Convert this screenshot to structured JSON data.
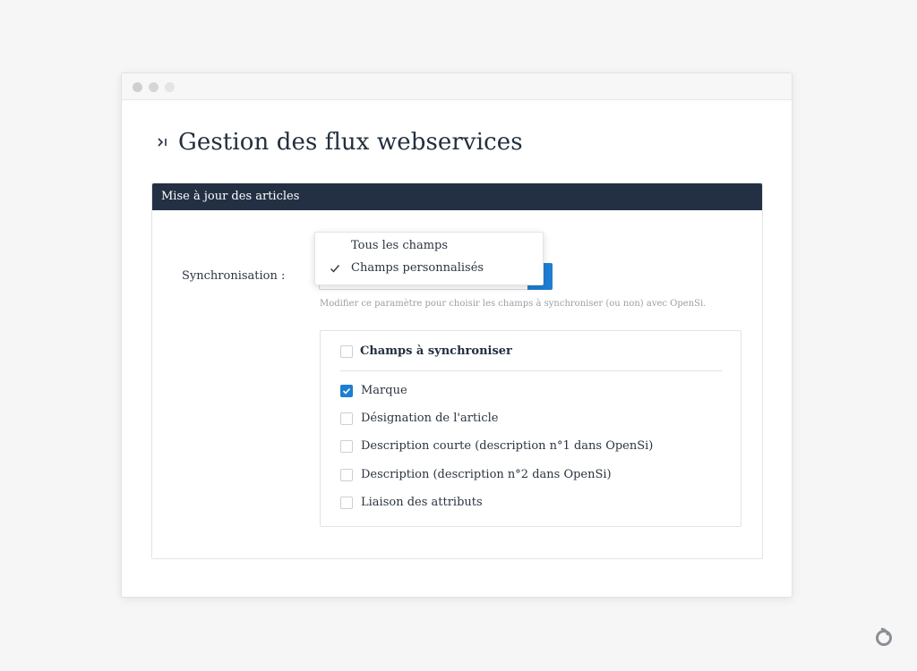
{
  "page": {
    "title": "Gestion des flux webservices"
  },
  "panel": {
    "header": "Mise à jour des articles",
    "sync_label": "Synchronisation :",
    "dropdown": {
      "options": [
        {
          "label": "Tous les champs",
          "selected": false
        },
        {
          "label": "Champs personnalisés",
          "selected": true
        }
      ]
    },
    "help_text": "Modifier ce paramètre pour choisir les champs à synchroniser (ou non) avec OpenSi.",
    "fields": {
      "title": "Champs à synchroniser",
      "title_checked": false,
      "items": [
        {
          "label": "Marque",
          "checked": true
        },
        {
          "label": "Désignation de l'article",
          "checked": false
        },
        {
          "label": "Description courte (description n°1 dans OpenSi)",
          "checked": false
        },
        {
          "label": "Description (description n°2 dans OpenSi)",
          "checked": false
        },
        {
          "label": "Liaison des attributs",
          "checked": false
        }
      ]
    }
  },
  "colors": {
    "header_bg": "#233044",
    "accent": "#1e7ed2",
    "page_bg": "#f6f6f6"
  },
  "icons": {
    "title_icon": "collapse-right-icon",
    "check_icon": "check-icon",
    "logo": "opensi-logo-icon"
  }
}
